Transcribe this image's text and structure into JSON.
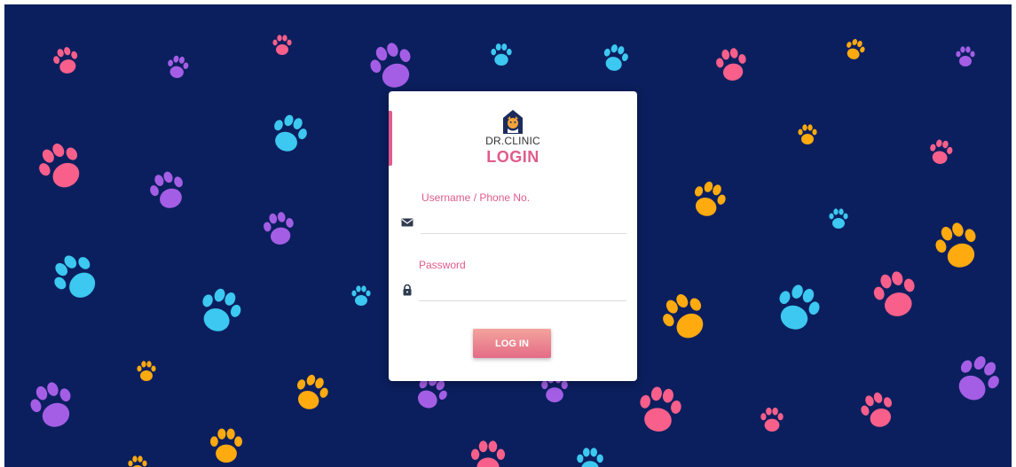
{
  "app": {
    "brand": "DR.CLINIC",
    "logo_icon": "clinic-house-pet-icon"
  },
  "login": {
    "title": "LOGIN",
    "username_label": "Username / Phone No.",
    "username_value": "",
    "username_icon": "envelope-icon",
    "password_label": "Password",
    "password_value": "",
    "password_icon": "lock-icon",
    "submit_label": "LOG IN"
  },
  "theme": {
    "background": "#0b1f5e",
    "accent": "#e05b8b",
    "paw_colors": [
      "#a45ee5",
      "#3cc8f0",
      "#f95f8b",
      "#ffaa0f"
    ]
  }
}
